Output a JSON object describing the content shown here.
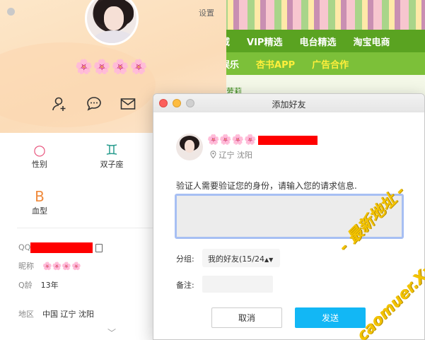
{
  "site": {
    "nav_row1": [
      "域",
      "VIP精选",
      "电台精选",
      "淘宝电商"
    ],
    "nav_row2": [
      "娱乐",
      "杏书APP",
      "广告合作"
    ],
    "link_text": "萝莉"
  },
  "profile": {
    "settings_label": "设置",
    "nickname_flowers": "🌸🌸🌸🌸",
    "tags": [
      {
        "icon": "○",
        "label": "性别",
        "color": "#e8507a"
      },
      {
        "icon": "♊",
        "label": "双子座",
        "color": "#2a9d8f"
      },
      {
        "icon": "B",
        "label": "血型",
        "color": "#f08a3c"
      }
    ],
    "info": {
      "qq_label": "QQ",
      "nick_label": "昵称",
      "nick_value": "🌸🌸🌸🌸",
      "age_label": "Q龄",
      "age_value": "13年",
      "region_label": "地区",
      "region_value": "中国  辽宁  沈阳"
    }
  },
  "dialog": {
    "title": "添加好友",
    "nickname_flowers": "🌸🌸🌸🌸",
    "location": "辽宁 沈阳",
    "prompt": "验证人需要验证您的身份，请输入您的请求信息.",
    "message_value": "",
    "group_label": "分组:",
    "group_value": "我的好友(15/24",
    "remark_label": "备注:",
    "remark_value": "",
    "cancel_label": "取消",
    "send_label": "发送"
  },
  "watermark": {
    "line1": "- 最新地址 -",
    "line2": "caomuer.Xyz"
  },
  "colors": {
    "send_button": "#12b7f5",
    "nav_green": "#5aa321",
    "redaction": "#ff0000"
  }
}
